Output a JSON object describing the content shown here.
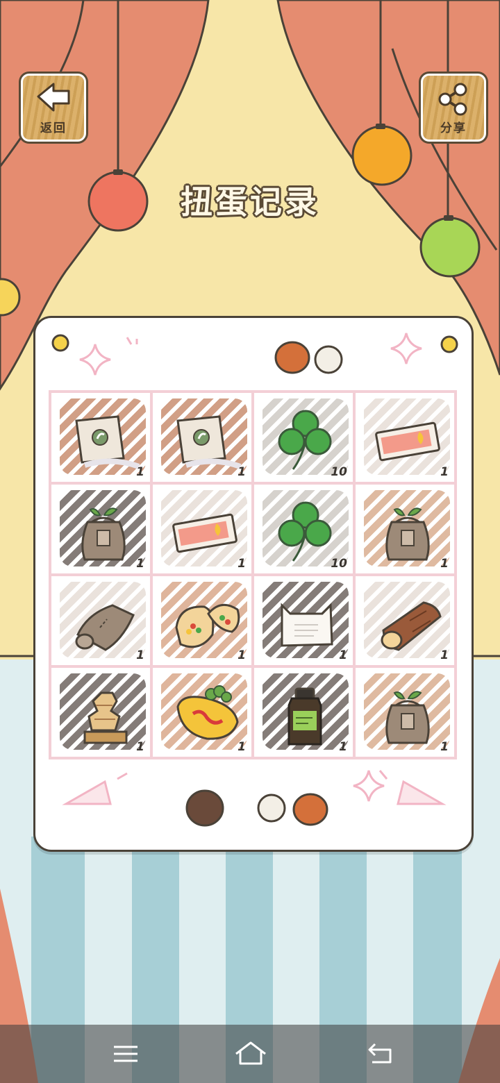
{
  "header": {
    "back_label": "返回",
    "share_label": "分享",
    "title": "扭蛋记录"
  },
  "records": [
    {
      "item": "seed-packet-icon",
      "count": "1",
      "hatch": "#c98e70"
    },
    {
      "item": "seed-packet-icon",
      "count": "1",
      "hatch": "#c98e70"
    },
    {
      "item": "clover-icon",
      "count": "10",
      "hatch": "#cfcac4"
    },
    {
      "item": "ticket-icon",
      "count": "1",
      "hatch": "#e6ddd6"
    },
    {
      "item": "plant-sack-icon",
      "count": "1",
      "hatch": "#6f6560"
    },
    {
      "item": "ticket-icon",
      "count": "1",
      "hatch": "#e6ddd6"
    },
    {
      "item": "clover-icon",
      "count": "10",
      "hatch": "#cfcac4"
    },
    {
      "item": "plant-sack-icon",
      "count": "1",
      "hatch": "#d9ae90"
    },
    {
      "item": "towel-icon",
      "count": "1",
      "hatch": "#e6ddd6"
    },
    {
      "item": "pita-bread-icon",
      "count": "1",
      "hatch": "#d9a88a"
    },
    {
      "item": "cat-pillow-icon",
      "count": "1",
      "hatch": "#6f6560"
    },
    {
      "item": "wood-log-icon",
      "count": "1",
      "hatch": "#e6ddd6"
    },
    {
      "item": "stone-tower-icon",
      "count": "1",
      "hatch": "#6f6560"
    },
    {
      "item": "omelette-icon",
      "count": "1",
      "hatch": "#d9a88a"
    },
    {
      "item": "medicine-bottle-icon",
      "count": "1",
      "hatch": "#6f6560"
    },
    {
      "item": "plant-sack-icon",
      "count": "1",
      "hatch": "#d9ae90"
    }
  ],
  "colors": {
    "curtain": "#e58c70",
    "wall": "#f7e6a8",
    "board_border": "#4a4238",
    "grid_line": "#f3cfd6"
  }
}
